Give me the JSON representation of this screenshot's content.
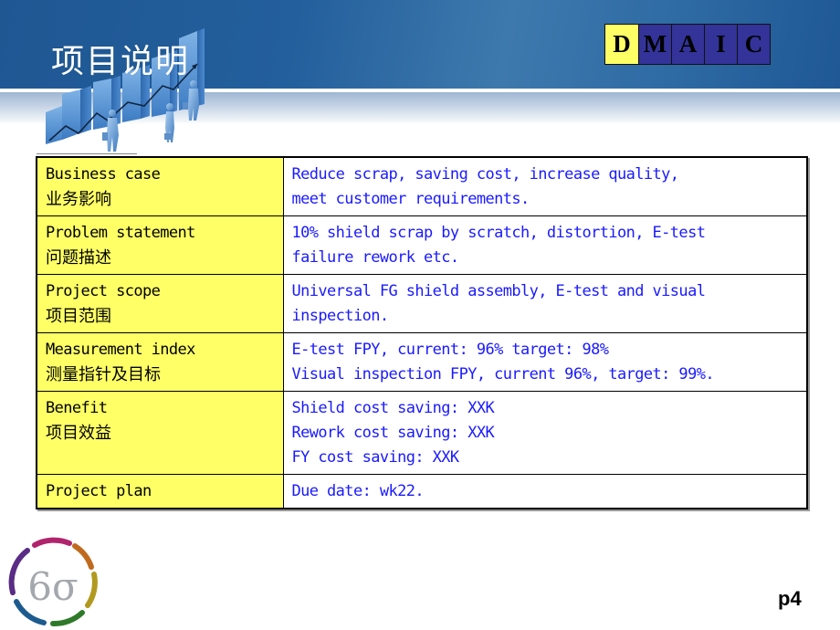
{
  "header": {
    "title": "项目说明",
    "illustration_icon": "rising-bar-chart-with-figures-icon"
  },
  "dmaic": {
    "phases": [
      {
        "letter": "D",
        "active": true
      },
      {
        "letter": "M",
        "active": false
      },
      {
        "letter": "A",
        "active": false
      },
      {
        "letter": "I",
        "active": false
      },
      {
        "letter": "C",
        "active": false
      }
    ],
    "active_color": "#ffff66",
    "inactive_color": "#333399"
  },
  "charter": {
    "rows": [
      {
        "label_en": "Business case",
        "label_zh": "业务影响",
        "value_lines": [
          "Reduce scrap, saving cost, increase quality,",
          "meet customer requirements."
        ]
      },
      {
        "label_en": "Problem statement",
        "label_zh": "问题描述",
        "value_lines": [
          "10% shield scrap by scratch, distortion, E-test",
          "failure rework etc."
        ]
      },
      {
        "label_en": "Project scope",
        "label_zh": "项目范围",
        "value_lines": [
          "Universal FG shield assembly, E-test and visual",
          "inspection."
        ]
      },
      {
        "label_en": "Measurement index",
        "label_zh": "测量指针及目标",
        "value_lines": [
          "E-test FPY, current: 96% target: 98%",
          "Visual inspection FPY, current 96%, target: 99%."
        ]
      },
      {
        "label_en": "Benefit",
        "label_zh": "项目效益",
        "value_lines": [
          "Shield cost saving: XXK",
          "Rework cost saving: XXK",
          "FY cost saving: XXK"
        ]
      },
      {
        "label_en": "Project plan",
        "label_zh": "",
        "value_lines": [
          "Due date: wk22."
        ]
      }
    ],
    "label_bg": "#ffff66",
    "value_text_color": "#1a1aff"
  },
  "footer": {
    "logo_text": "6σ",
    "page_number": "p4"
  }
}
